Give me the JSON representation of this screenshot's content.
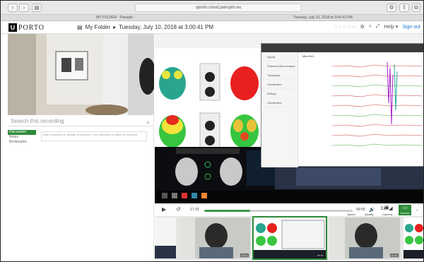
{
  "browser": {
    "url": "uporto.cloud.panopto.eu",
    "tab_title": "MY FOLDER - Panopto",
    "date_stamp": "Tuesday, July 10, 2018 at 3:00:41 PM"
  },
  "header": {
    "logo_letter": "U",
    "logo_text": "PORTO",
    "folder": "My Folder",
    "separator": "▸",
    "title": "Tuesday, July 10, 2018 at 3:00:41 PM",
    "help": "Help",
    "sign_out": "Sign out"
  },
  "left": {
    "search_placeholder": "Search this recording",
    "tabs": [
      "Discussion",
      "Notes",
      "Bookmarks"
    ],
    "discussion_placeholder": "Add a comment or answer a comment. Your comment is visible to everyone"
  },
  "app": {
    "title": "Mind BCI",
    "sidebar": [
      "Signals",
      "Frequency Band Analysis",
      "Topography",
      "Classification",
      "Settings",
      "Classification"
    ]
  },
  "controls": {
    "time_current": "17:33",
    "time_total": "59:55",
    "progress_fraction": 0.31,
    "speed_value": "1x",
    "speed_label": "Speed",
    "quality_label": "Quality",
    "camera_label": "Camera",
    "screen_label": "Screen"
  },
  "thumbs": [
    {
      "kind": "screen",
      "duration": ""
    },
    {
      "kind": "camera",
      "duration": "15:31"
    },
    {
      "kind": "screen",
      "duration": "15:31"
    },
    {
      "kind": "camera",
      "duration": "15:31"
    },
    {
      "kind": "screen",
      "duration": ""
    }
  ],
  "colors": {
    "accent": "#2e8b3a",
    "link": "#1a73c8"
  }
}
